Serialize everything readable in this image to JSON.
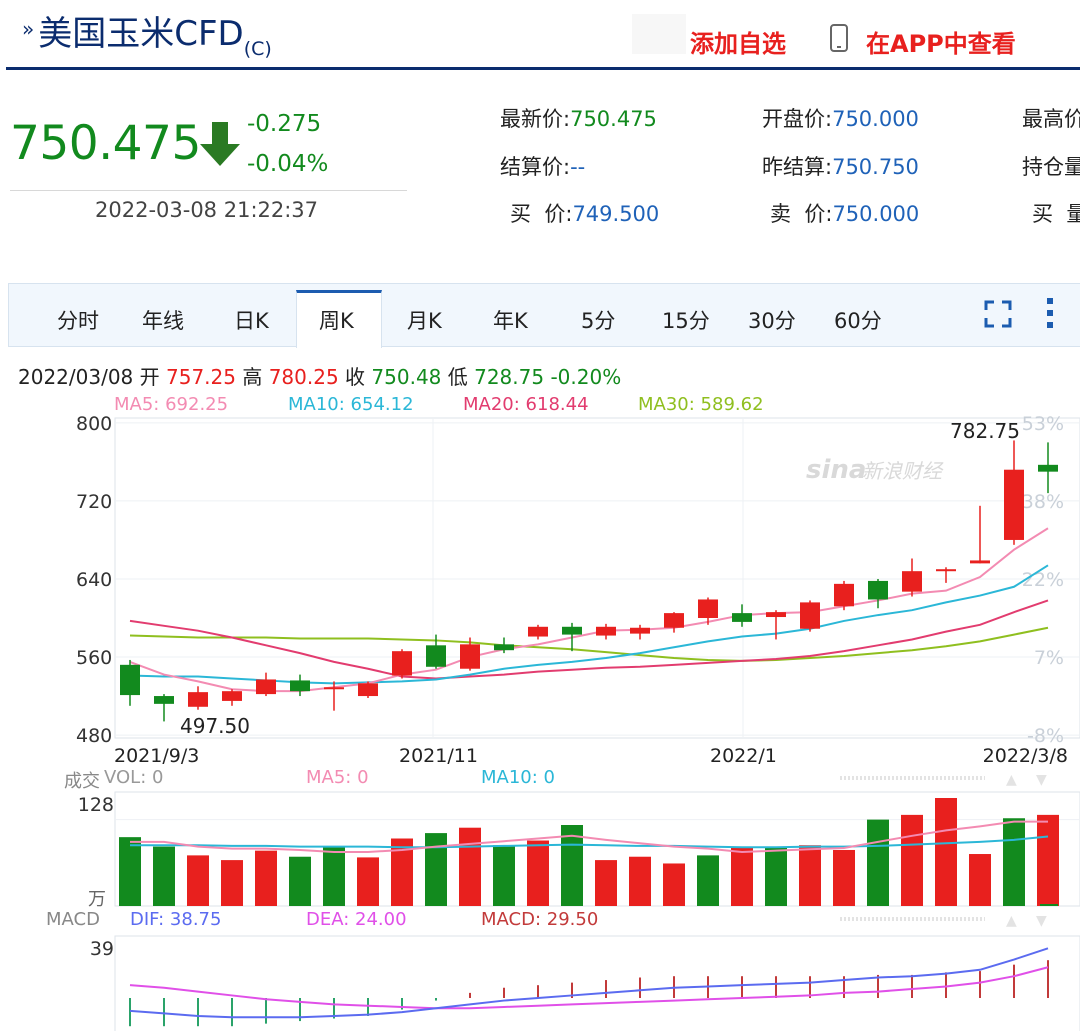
{
  "header": {
    "title": "美国玉米CFD",
    "title_suffix": "(C)",
    "add_watch_label": "添加自选",
    "app_view_label": "在APP中查看"
  },
  "quote": {
    "price": "750.475",
    "change": "-0.275",
    "change_pct": "-0.04%",
    "datetime": "2022-03-08 21:22:37",
    "latest_label": "最新价:",
    "latest_value": "750.475",
    "open_label": "开盘价:",
    "open_value": "750.000",
    "high_label": "最高价",
    "settle_label": "结算价:",
    "settle_value": "--",
    "prev_settle_label": "昨结算:",
    "prev_settle_value": "750.750",
    "open_interest_label": "持仓量",
    "bid_label": "买  价:",
    "bid_value": "749.500",
    "ask_label": "卖  价:",
    "ask_value": "750.000",
    "bid_vol_label": "买  量"
  },
  "tabs": [
    "分时",
    "年线",
    "日K",
    "周K",
    "月K",
    "年K",
    "5分",
    "15分",
    "30分",
    "60分"
  ],
  "active_tab": "周K",
  "info_bar": {
    "date": "2022/03/08",
    "open_label": "开",
    "open": "757.25",
    "high_label": "高",
    "high": "780.25",
    "close_label": "收",
    "close": "750.48",
    "low_label": "低",
    "low": "728.75",
    "pct": "-0.20%"
  },
  "ma_legend": {
    "ma5": "MA5: 692.25",
    "ma10": "MA10: 654.12",
    "ma20": "MA20: 618.44",
    "ma30": "MA30: 589.62"
  },
  "volume_legend": {
    "title": "成交",
    "vol": "VOL: 0",
    "ma5": "MA5: 0",
    "ma10": "MA10: 0",
    "unit": "万"
  },
  "macd_legend": {
    "title": "MACD",
    "dif": "DIF: 38.75",
    "dea": "DEA: 24.00",
    "macd": "MACD: 29.50"
  },
  "watermark": "新浪财经",
  "colors": {
    "up": "#e8201e",
    "down": "#128a1e",
    "ma5": "#f38bb2",
    "ma10": "#2bb7d7",
    "ma20": "#e23c6f",
    "ma30": "#8fbf1f",
    "dif": "#5b6bf0",
    "dea": "#e050e8",
    "macd_bar": "#c23a3a"
  },
  "chart_data": [
    {
      "type": "candlestick",
      "title": "",
      "yticks": [
        480,
        560,
        640,
        720,
        800
      ],
      "ylim": [
        477,
        805
      ],
      "right_pct_ticks": [
        "53%",
        "38%",
        "22%",
        "7%",
        "-8%"
      ],
      "x_ticks": [
        "2021/9/3",
        "2021/11",
        "2022/1",
        "2022/3/8"
      ],
      "annotations": {
        "max_label": "782.75",
        "min_label": "497.50"
      },
      "candles": [
        {
          "o": 552,
          "c": 521,
          "h": 557,
          "l": 510
        },
        {
          "o": 520,
          "c": 512,
          "h": 522,
          "l": 494
        },
        {
          "o": 509,
          "c": 524,
          "h": 530,
          "l": 506
        },
        {
          "o": 515,
          "c": 525,
          "h": 527,
          "l": 510
        },
        {
          "o": 522,
          "c": 537,
          "h": 544,
          "l": 520
        },
        {
          "o": 536,
          "c": 525,
          "h": 542,
          "l": 520
        },
        {
          "o": 527,
          "c": 529,
          "h": 535,
          "l": 505
        },
        {
          "o": 520,
          "c": 533,
          "h": 535,
          "l": 518
        },
        {
          "o": 541,
          "c": 566,
          "h": 568,
          "l": 538
        },
        {
          "o": 572,
          "c": 550,
          "h": 583,
          "l": 548
        },
        {
          "o": 548,
          "c": 573,
          "h": 580,
          "l": 546
        },
        {
          "o": 573,
          "c": 567,
          "h": 580,
          "l": 564
        },
        {
          "o": 581,
          "c": 591,
          "h": 593,
          "l": 578
        },
        {
          "o": 591,
          "c": 583,
          "h": 595,
          "l": 566
        },
        {
          "o": 582,
          "c": 591,
          "h": 594,
          "l": 578
        },
        {
          "o": 584,
          "c": 590,
          "h": 593,
          "l": 578
        },
        {
          "o": 590,
          "c": 605,
          "h": 606,
          "l": 585
        },
        {
          "o": 600,
          "c": 619,
          "h": 621,
          "l": 593
        },
        {
          "o": 605,
          "c": 596,
          "h": 614,
          "l": 591
        },
        {
          "o": 601,
          "c": 606,
          "h": 608,
          "l": 578
        },
        {
          "o": 589,
          "c": 616,
          "h": 618,
          "l": 586
        },
        {
          "o": 612,
          "c": 635,
          "h": 638,
          "l": 608
        },
        {
          "o": 638,
          "c": 619,
          "h": 640,
          "l": 610
        },
        {
          "o": 627,
          "c": 648,
          "h": 661,
          "l": 622
        },
        {
          "o": 649,
          "c": 650,
          "h": 652,
          "l": 636
        },
        {
          "o": 656,
          "c": 659,
          "h": 715,
          "l": 656
        },
        {
          "o": 680,
          "c": 752,
          "h": 782,
          "l": 675
        },
        {
          "o": 757,
          "c": 750,
          "h": 780,
          "l": 728
        }
      ],
      "ma": {
        "ma5": [
          555,
          542,
          535,
          527,
          525,
          525,
          529,
          533,
          542,
          547,
          560,
          568,
          573,
          580,
          587,
          588,
          590,
          596,
          603,
          605,
          606,
          612,
          618,
          625,
          628,
          642,
          670,
          692
        ],
        "ma10": [
          541,
          540,
          540,
          538,
          536,
          534,
          533,
          534,
          535,
          537,
          542,
          548,
          552,
          555,
          559,
          564,
          570,
          576,
          581,
          584,
          589,
          597,
          603,
          608,
          616,
          623,
          632,
          654
        ],
        "ma20": [
          597,
          592,
          587,
          580,
          572,
          564,
          555,
          548,
          540,
          538,
          540,
          542,
          545,
          547,
          549,
          550,
          552,
          554,
          556,
          558,
          561,
          566,
          572,
          578,
          586,
          593,
          606,
          618
        ],
        "ma30": [
          582,
          581,
          580,
          580,
          580,
          579,
          579,
          579,
          578,
          577,
          575,
          572,
          570,
          568,
          565,
          562,
          559,
          557,
          556,
          557,
          559,
          561,
          564,
          567,
          571,
          576,
          583,
          590
        ]
      }
    },
    {
      "type": "bar",
      "title": "成交",
      "yticks": [
        128
      ],
      "values": [
        102,
        88,
        75,
        68,
        82,
        73,
        88,
        72,
        100,
        108,
        116,
        90,
        97,
        120,
        68,
        73,
        63,
        75,
        87,
        88,
        90,
        83,
        128,
        135,
        160,
        77,
        130,
        135
      ],
      "up": [
        false,
        false,
        true,
        true,
        true,
        false,
        false,
        true,
        true,
        false,
        true,
        false,
        true,
        false,
        true,
        true,
        true,
        false,
        true,
        false,
        true,
        true,
        false,
        true,
        true,
        true,
        false,
        true
      ],
      "ma5": [
        95,
        95,
        88,
        85,
        85,
        83,
        80,
        80,
        83,
        88,
        92,
        96,
        100,
        104,
        98,
        93,
        88,
        85,
        80,
        82,
        84,
        86,
        95,
        104,
        112,
        118,
        125,
        125
      ],
      "ma10": [
        90,
        90,
        90,
        89,
        89,
        88,
        88,
        88,
        87,
        87,
        88,
        89,
        90,
        91,
        90,
        89,
        89,
        88,
        87,
        87,
        88,
        88,
        89,
        91,
        93,
        95,
        98,
        103
      ]
    },
    {
      "type": "macd",
      "title": "MACD",
      "yticks": [
        39
      ],
      "dif": [
        -10,
        -12,
        -14,
        -15,
        -15,
        -15,
        -14,
        -13,
        -11,
        -8,
        -5,
        -2,
        0,
        2,
        4,
        6,
        8,
        9,
        10,
        11,
        12,
        14,
        16,
        17,
        19,
        22,
        30,
        38.75
      ],
      "dea": [
        10,
        8,
        5,
        2,
        -1,
        -3,
        -5,
        -6,
        -7,
        -8,
        -8,
        -7,
        -6,
        -5,
        -4,
        -3,
        -2,
        -1,
        0,
        1,
        2,
        4,
        5,
        7,
        9,
        12,
        17,
        24
      ],
      "macd": [
        -22,
        -22,
        -22,
        -22,
        -20,
        -18,
        -16,
        -14,
        -9,
        -2,
        4,
        8,
        10,
        12,
        14,
        16,
        17,
        17,
        17,
        17,
        17,
        17,
        18,
        18,
        20,
        21,
        26,
        29.5
      ]
    }
  ]
}
